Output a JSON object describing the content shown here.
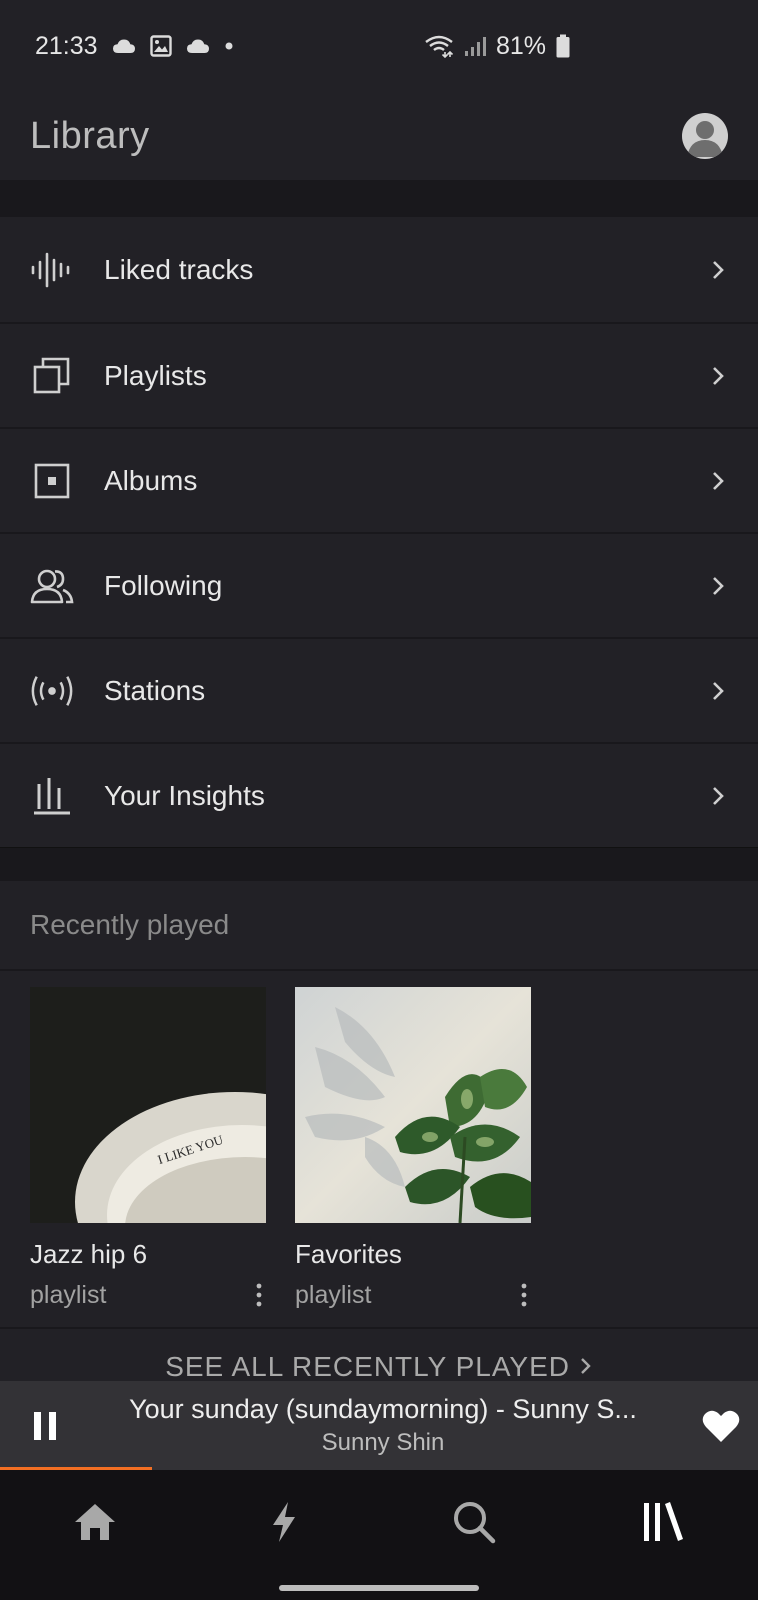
{
  "status_bar": {
    "time": "21:33",
    "battery": "81%",
    "icons": [
      "cloud-icon",
      "image-icon",
      "cloud-icon",
      "dot-icon",
      "wifi-icon",
      "signal-icon",
      "battery-icon"
    ]
  },
  "header": {
    "title": "Library",
    "avatar_icon": "avatar-icon"
  },
  "menu": {
    "items": [
      {
        "label": "Liked tracks",
        "icon": "waveform-icon"
      },
      {
        "label": "Playlists",
        "icon": "playlists-icon"
      },
      {
        "label": "Albums",
        "icon": "album-icon"
      },
      {
        "label": "Following",
        "icon": "following-icon"
      },
      {
        "label": "Stations",
        "icon": "station-icon"
      },
      {
        "label": "Your Insights",
        "icon": "insights-icon"
      }
    ]
  },
  "recent": {
    "heading": "Recently played",
    "cards": [
      {
        "title": "Jazz hip 6",
        "subtitle": "playlist",
        "art_text": "I LIKE YOU"
      },
      {
        "title": "Favorites",
        "subtitle": "playlist"
      }
    ],
    "see_all": "SEE ALL RECENTLY PLAYED"
  },
  "player": {
    "track": "Your sunday (sundaymorning) - Sunny S...",
    "artist": "Sunny Shin",
    "progress": 0.2,
    "accent_color": "#f26f23"
  },
  "bottom_nav": {
    "items": [
      "home-icon",
      "feed-icon",
      "search-icon",
      "library-icon"
    ],
    "active": "library-icon"
  }
}
